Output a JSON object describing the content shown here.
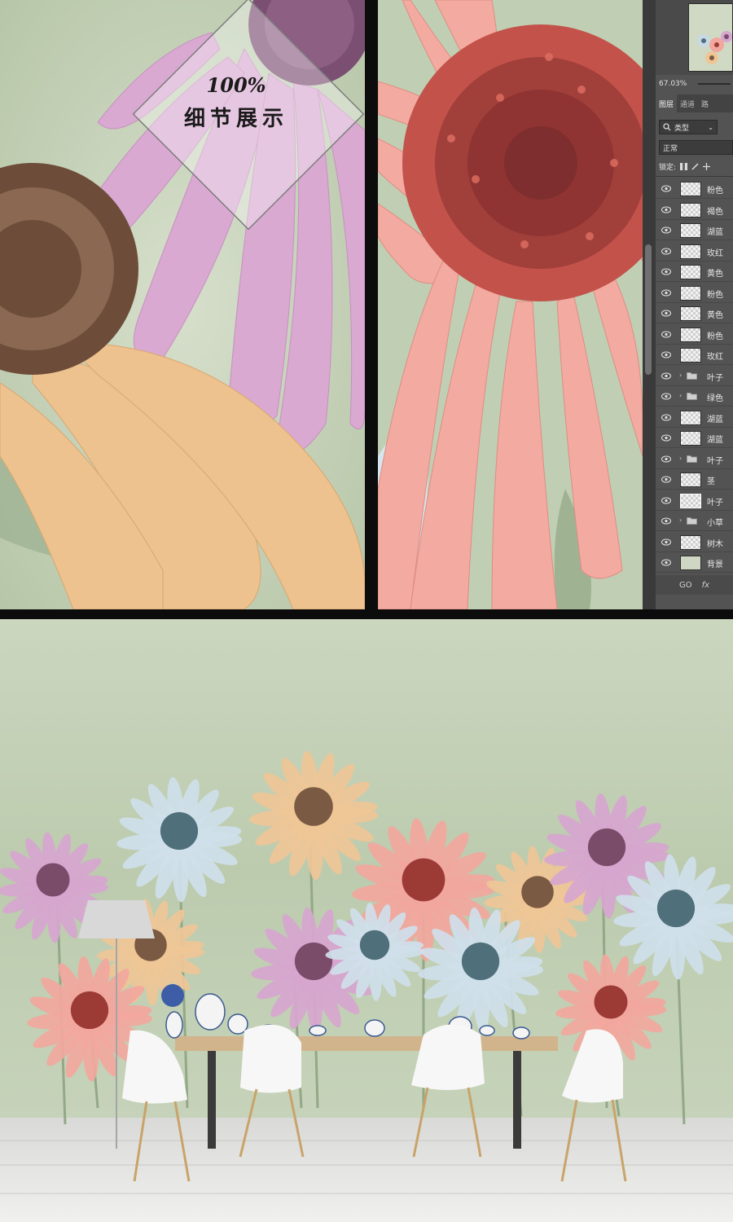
{
  "detail_label": {
    "percent": "100%",
    "text": "细节展示"
  },
  "photoshop": {
    "zoom": "67.03%",
    "tabs": [
      "图层",
      "通道",
      "路"
    ],
    "active_tab": 0,
    "filter_label": "类型",
    "blend_mode": "正常",
    "lock_label": "锁定:",
    "layers": [
      {
        "name": "粉色",
        "kind": "raster"
      },
      {
        "name": "褐色",
        "kind": "raster"
      },
      {
        "name": "湖蓝",
        "kind": "raster"
      },
      {
        "name": "玫红",
        "kind": "raster"
      },
      {
        "name": "黄色",
        "kind": "raster"
      },
      {
        "name": "粉色",
        "kind": "raster"
      },
      {
        "name": "黄色",
        "kind": "raster"
      },
      {
        "name": "粉色",
        "kind": "raster"
      },
      {
        "name": "玫红",
        "kind": "raster"
      },
      {
        "name": "叶子",
        "kind": "folder"
      },
      {
        "name": "绿色",
        "kind": "folder"
      },
      {
        "name": "湖蓝",
        "kind": "raster"
      },
      {
        "name": "湖蓝",
        "kind": "raster"
      },
      {
        "name": "叶子",
        "kind": "folder"
      },
      {
        "name": "茎",
        "kind": "raster"
      },
      {
        "name": "叶子",
        "kind": "raster-selected"
      },
      {
        "name": "小草",
        "kind": "folder"
      },
      {
        "name": "树木",
        "kind": "raster"
      },
      {
        "name": "背景",
        "kind": "solid"
      }
    ],
    "bottom_icons": [
      "GO",
      "fx"
    ]
  },
  "colors": {
    "background_green": "#c5d2b9",
    "petal_pink": "#f2a79d",
    "petal_lilac": "#d7a6cf",
    "petal_peach": "#efc596",
    "petal_blue": "#cfe0ea",
    "core_red": "#9c3a36",
    "core_brown": "#7b5a44",
    "core_teal": "#4f6f7a",
    "core_plum": "#7a4c6a"
  }
}
